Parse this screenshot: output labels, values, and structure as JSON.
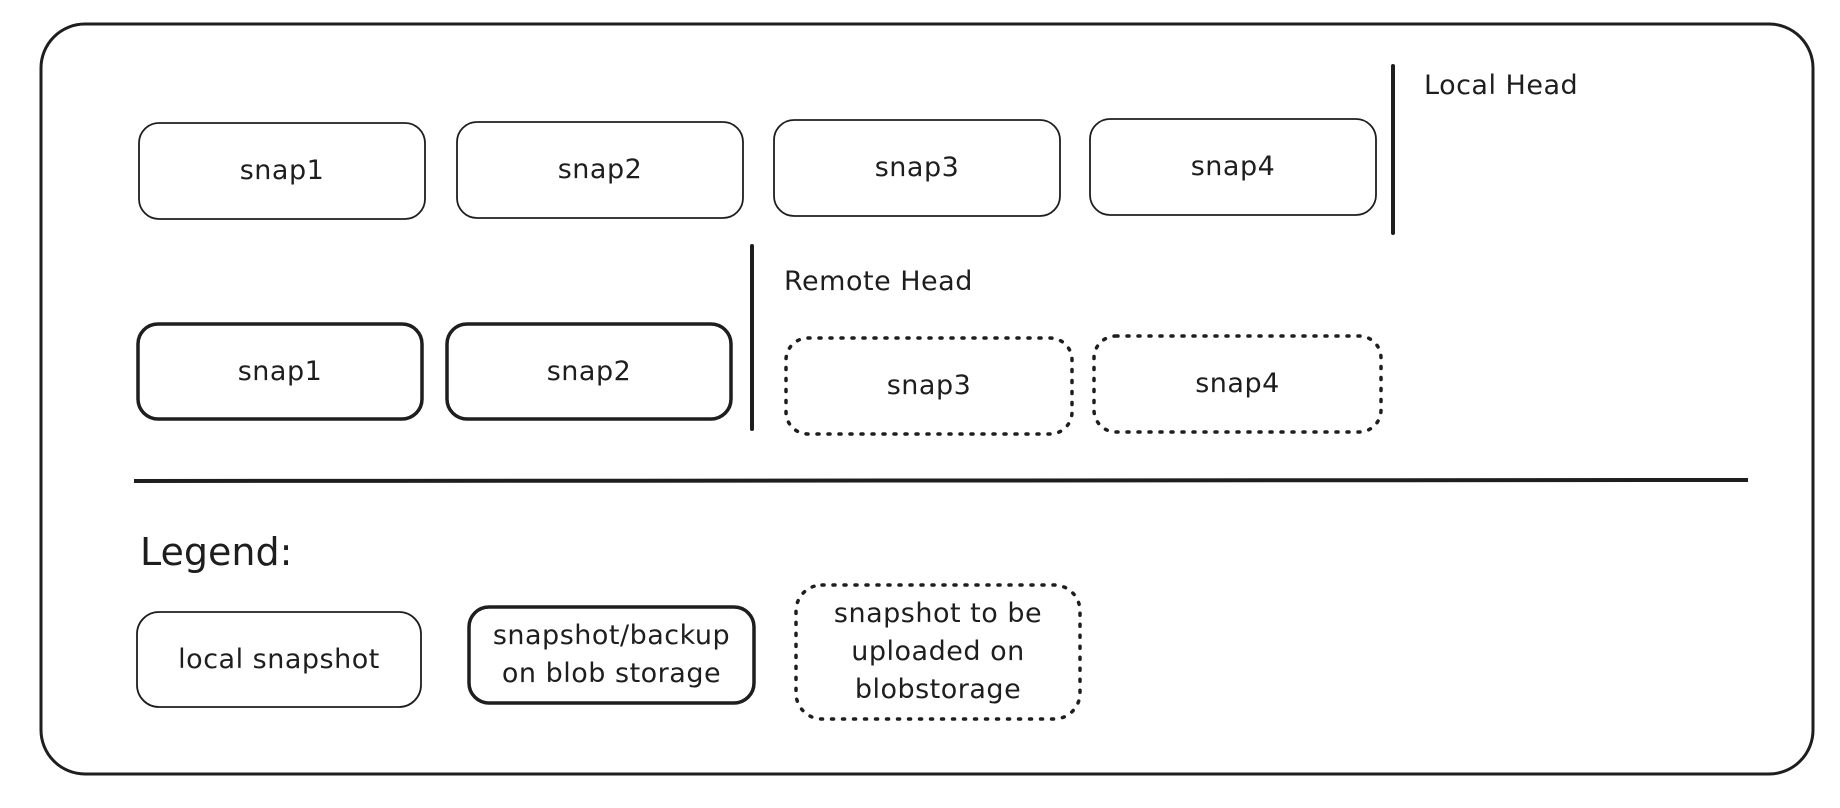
{
  "diagram": {
    "local_row": {
      "head_label": "Local Head",
      "snapshots": [
        "snap1",
        "snap2",
        "snap3",
        "snap4"
      ]
    },
    "remote_row": {
      "head_label": "Remote Head",
      "uploaded_snapshots": [
        "snap1",
        "snap2"
      ],
      "pending_snapshots": [
        "snap3",
        "snap4"
      ]
    },
    "legend": {
      "title": "Legend:",
      "items": [
        {
          "style": "thin-solid",
          "label": "local snapshot"
        },
        {
          "style": "thick-solid",
          "label": "snapshot/backup on blob storage"
        },
        {
          "style": "dotted",
          "label": "snapshot to be uploaded on blobstorage"
        }
      ]
    },
    "colors": {
      "stroke": "#1e1e1e",
      "background": "#ffffff"
    }
  }
}
